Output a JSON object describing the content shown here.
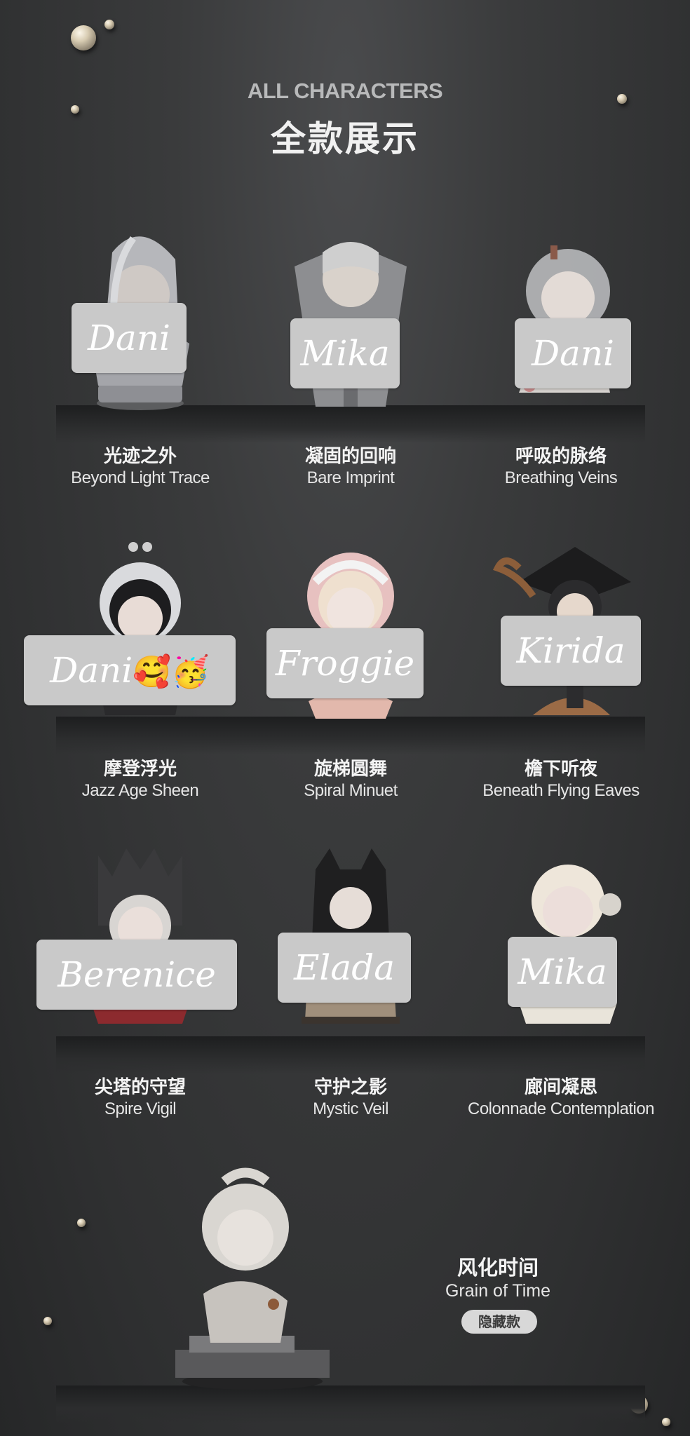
{
  "header": {
    "title_en": "ALL CHARACTERS",
    "title_zh": "全款展示"
  },
  "characters": [
    {
      "zh": "光迹之外",
      "en": "Beyond Light Trace",
      "tag": "Dani",
      "tag_emoji": ""
    },
    {
      "zh": "凝固的回响",
      "en": "Bare Imprint",
      "tag": "Mika",
      "tag_emoji": ""
    },
    {
      "zh": "呼吸的脉络",
      "en": "Breathing Veins",
      "tag": "Dani",
      "tag_emoji": ""
    },
    {
      "zh": "摩登浮光",
      "en": "Jazz Age Sheen",
      "tag": "Dani",
      "tag_emoji": "🥰🥳"
    },
    {
      "zh": "旋梯圆舞",
      "en": "Spiral Minuet",
      "tag": "Froggie",
      "tag_emoji": ""
    },
    {
      "zh": "檐下听夜",
      "en": "Beneath Flying Eaves",
      "tag": "Kirida",
      "tag_emoji": ""
    },
    {
      "zh": "尖塔的守望",
      "en": "Spire Vigil",
      "tag": "Berenice",
      "tag_emoji": ""
    },
    {
      "zh": "守护之影",
      "en": "Mystic Veil",
      "tag": "Elada",
      "tag_emoji": ""
    },
    {
      "zh": "廊间凝思",
      "en": "Colonnade Contemplation",
      "tag": "Mika",
      "tag_emoji": ""
    }
  ],
  "hidden": {
    "zh": "风化时间",
    "en": "Grain of Time",
    "badge": "隐藏款"
  },
  "colors": {
    "background": "#333435",
    "tag": "#c9c9c9",
    "badge": "#d8d8d8"
  }
}
